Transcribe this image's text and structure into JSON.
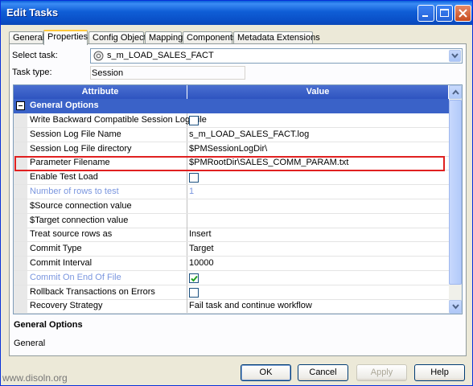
{
  "window": {
    "title": "Edit Tasks"
  },
  "tabs": [
    "General",
    "Properties",
    "Config Object",
    "Mapping",
    "Components",
    "Metadata Extensions"
  ],
  "active_tab": "Properties",
  "select_task": {
    "label": "Select task:",
    "value": "s_m_LOAD_SALES_FACT"
  },
  "task_type": {
    "label": "Task type:",
    "value": "Session"
  },
  "grid": {
    "headers": {
      "attribute": "Attribute",
      "value": "Value"
    },
    "group": "General Options",
    "rows": [
      {
        "attribute": "Write Backward Compatible Session Log File",
        "value": "",
        "type": "checkbox",
        "checked": false,
        "disabled": false
      },
      {
        "attribute": "Session Log File Name",
        "value": "s_m_LOAD_SALES_FACT.log",
        "type": "text",
        "disabled": false
      },
      {
        "attribute": "Session Log File directory",
        "value": "$PMSessionLogDir\\",
        "type": "text",
        "disabled": false
      },
      {
        "attribute": "Parameter Filename",
        "value": "$PMRootDir\\SALES_COMM_PARAM.txt",
        "type": "text",
        "disabled": false,
        "highlighted": true
      },
      {
        "attribute": "Enable Test Load",
        "value": "",
        "type": "checkbox",
        "checked": false,
        "disabled": false
      },
      {
        "attribute": "Number of rows to test",
        "value": "1",
        "type": "text",
        "disabled": true
      },
      {
        "attribute": "$Source connection value",
        "value": "",
        "type": "text",
        "disabled": false
      },
      {
        "attribute": "$Target connection value",
        "value": "",
        "type": "text",
        "disabled": false
      },
      {
        "attribute": "Treat source rows as",
        "value": "Insert",
        "type": "text",
        "disabled": false
      },
      {
        "attribute": "Commit Type",
        "value": "Target",
        "type": "text",
        "disabled": false
      },
      {
        "attribute": "Commit Interval",
        "value": "10000",
        "type": "text",
        "disabled": false
      },
      {
        "attribute": "Commit On End Of File",
        "value": "",
        "type": "checkbox",
        "checked": true,
        "disabled": true
      },
      {
        "attribute": "Rollback Transactions on Errors",
        "value": "",
        "type": "checkbox",
        "checked": false,
        "disabled": false
      },
      {
        "attribute": "Recovery Strategy",
        "value": "Fail task and continue workflow",
        "type": "text",
        "disabled": false
      }
    ]
  },
  "description": {
    "heading": "General Options",
    "body": "General"
  },
  "buttons": {
    "ok": "OK",
    "cancel": "Cancel",
    "apply": "Apply",
    "help": "Help"
  },
  "watermark": "www.disoln.org"
}
